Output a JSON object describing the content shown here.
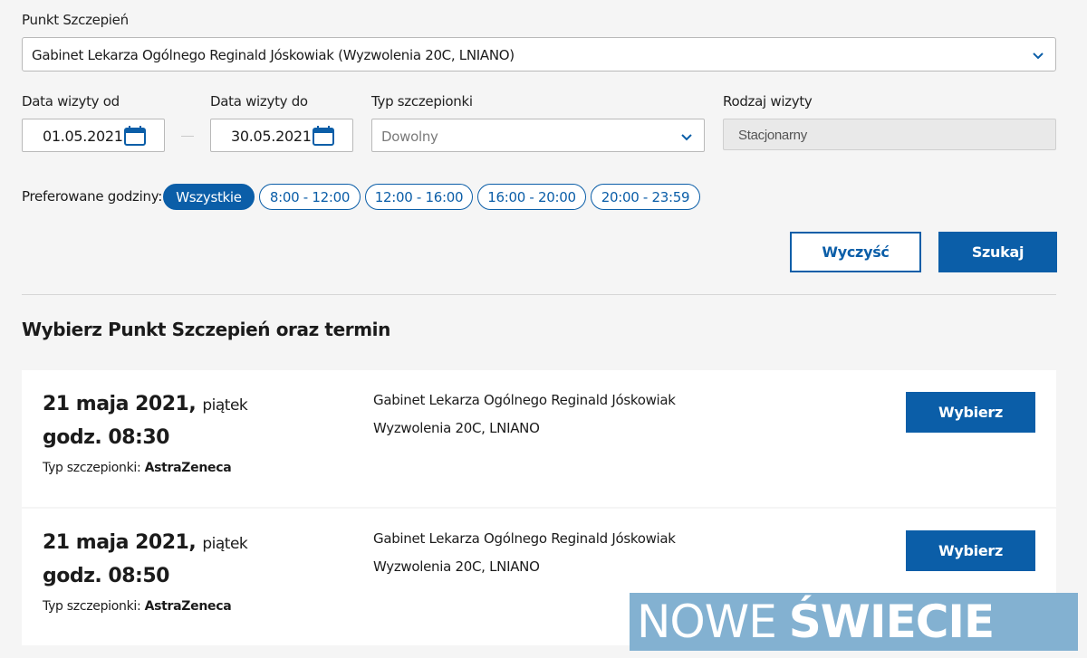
{
  "filters": {
    "point_label": "Punkt Szczepień",
    "point_value": "Gabinet Lekarza Ogólnego Reginald Jóskowiak (Wyzwolenia 20C, LNIANO)",
    "date_from_label": "Data wizyty od",
    "date_from_value": "01.05.2021",
    "date_to_label": "Data wizyty do",
    "date_to_value": "30.05.2021",
    "vaccine_type_label": "Typ szczepionki",
    "vaccine_type_value": "Dowolny",
    "visit_type_label": "Rodzaj wizyty",
    "visit_type_value": "Stacjonarny",
    "hours_label": "Preferowane godziny:",
    "hours": [
      "Wszystkie",
      "8:00 - 12:00",
      "12:00 - 16:00",
      "16:00 - 20:00",
      "20:00 - 23:59"
    ],
    "clear_label": "Wyczyść",
    "search_label": "Szukaj"
  },
  "results": {
    "title": "Wybierz Punkt Szczepień oraz termin",
    "vtype_label": "Typ szczepionki:",
    "pick_label": "Wybierz",
    "items": [
      {
        "date": "21 maja 2021,",
        "dow": "piątek",
        "time": "godz. 08:30",
        "vaccine": "AstraZeneca",
        "place": "Gabinet Lekarza Ogólnego Reginald Jóskowiak",
        "address": "Wyzwolenia 20C, LNIANO"
      },
      {
        "date": "21 maja 2021,",
        "dow": "piątek",
        "time": "godz. 08:50",
        "vaccine": "AstraZeneca",
        "place": "Gabinet Lekarza Ogólnego Reginald Jóskowiak",
        "address": "Wyzwolenia 20C, LNIANO"
      }
    ]
  },
  "watermark": {
    "part1": "NOWE",
    "part2": "ŚWIECIE"
  },
  "colors": {
    "accent": "#0b5ea8",
    "background": "#f5f5f5"
  }
}
